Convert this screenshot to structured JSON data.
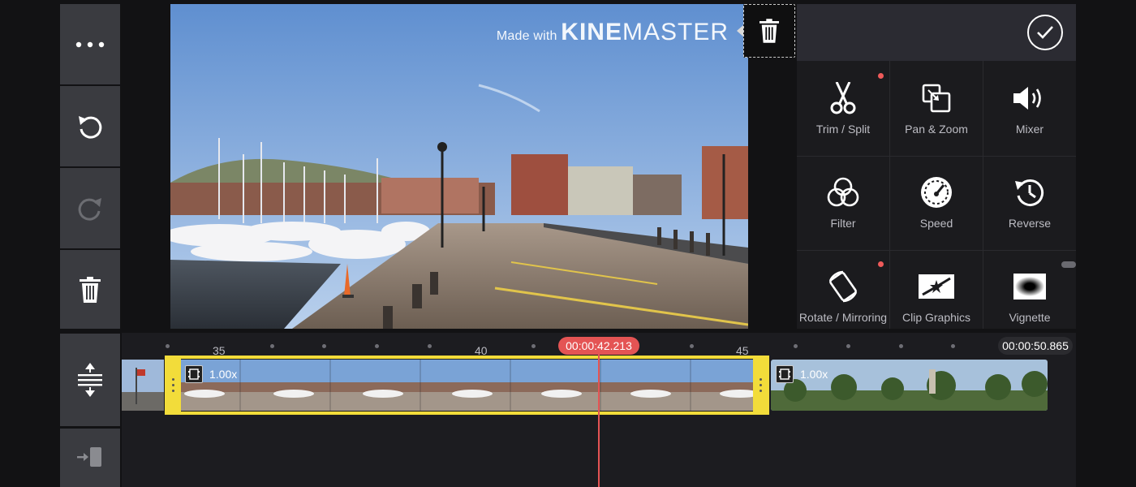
{
  "toolbar": {
    "more_icon": "more-horizontal-icon",
    "undo_icon": "undo-icon",
    "redo_icon": "redo-icon",
    "delete_icon": "trash-icon",
    "expand_icon": "expand-vertical-icon",
    "exit_icon": "exit-icon"
  },
  "preview": {
    "watermark_prefix": "Made with",
    "watermark_bold": "KINE",
    "watermark_light": "MASTER"
  },
  "panel": {
    "tools": [
      {
        "label": "Trim / Split",
        "icon": "scissors-icon",
        "new": true
      },
      {
        "label": "Pan & Zoom",
        "icon": "pan-zoom-icon",
        "new": false
      },
      {
        "label": "Mixer",
        "icon": "speaker-icon",
        "new": false
      },
      {
        "label": "Filter",
        "icon": "filter-icon",
        "new": false
      },
      {
        "label": "Speed",
        "icon": "speedometer-icon",
        "new": false
      },
      {
        "label": "Reverse",
        "icon": "reverse-icon",
        "new": false
      },
      {
        "label": "Rotate / Mirroring",
        "icon": "rotate-icon",
        "new": true
      },
      {
        "label": "Clip Graphics",
        "icon": "clip-graphics-icon",
        "new": false
      },
      {
        "label": "Vignette",
        "icon": "vignette-icon",
        "new": false
      }
    ]
  },
  "timeline": {
    "ticks": [
      "35",
      "40",
      "45"
    ],
    "current_time": "00:00:42.213",
    "end_time": "00:00:50.865",
    "clips": [
      {
        "speed": "1.00x"
      },
      {
        "speed": "1.00x"
      }
    ]
  },
  "colors": {
    "accent_red": "#e45454",
    "selection_yellow": "#f2dc3a"
  }
}
